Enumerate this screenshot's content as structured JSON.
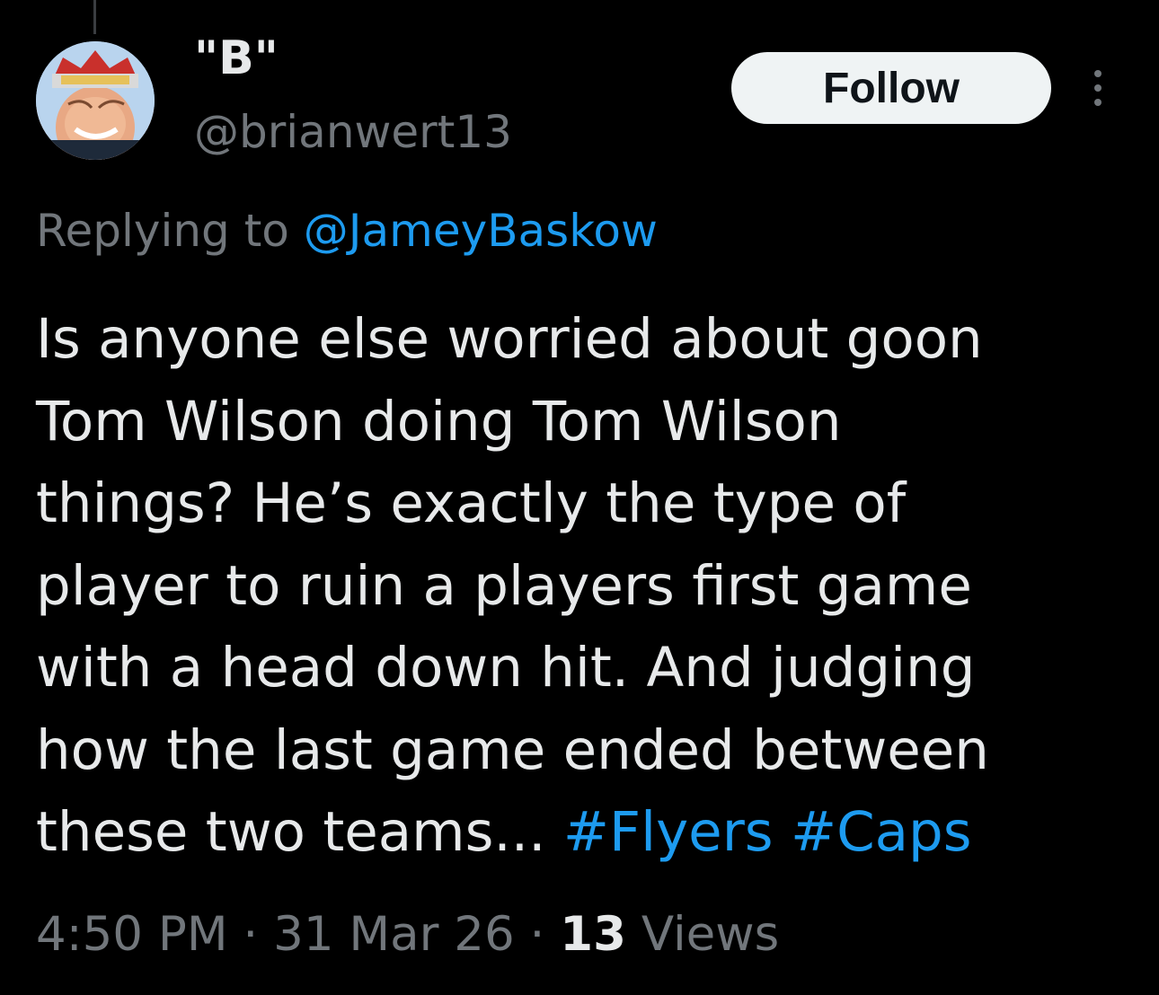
{
  "tweet": {
    "author": {
      "display_name": "\"B\"",
      "handle": "@brianwert13"
    },
    "follow_label": "Follow",
    "reply": {
      "prefix": "Replying to ",
      "mention": "@JameyBaskow"
    },
    "text_lines": [
      "Is anyone else worried about goon",
      "Tom Wilson doing Tom Wilson",
      "things? He’s exactly the type of",
      "player to ruin a players first game",
      "with a head down hit. And judging",
      "how the last game ended between",
      "these two teams... "
    ],
    "hashtags": [
      "#Flyers",
      "#Caps"
    ],
    "meta": {
      "time": "4:50 PM",
      "separator": " · ",
      "date": "31 Mar 26",
      "views_count": "13",
      "views_label": " Views"
    }
  },
  "colors": {
    "background": "#000000",
    "primary_text": "#e7e9ea",
    "secondary_text": "#71767b",
    "accent": "#1d9bf0",
    "follow_bg": "#eff3f4"
  },
  "icons": {
    "avatar": "profile-photo",
    "more": "more-options-icon"
  }
}
